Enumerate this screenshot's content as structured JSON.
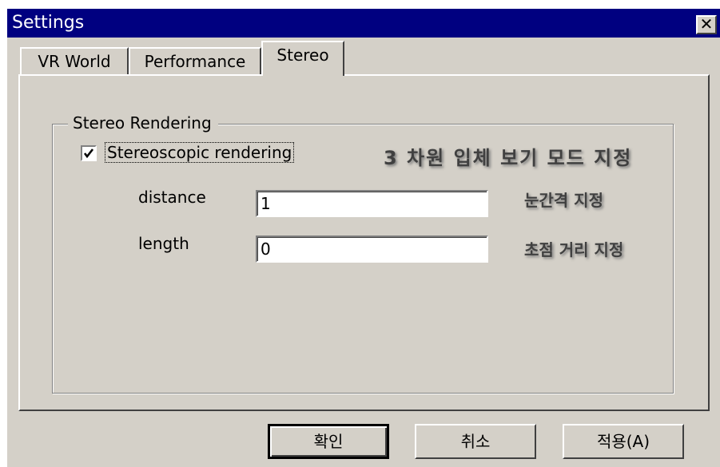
{
  "window": {
    "title": "Settings",
    "close_glyph": "✕"
  },
  "tabs": [
    {
      "label": "VR World",
      "active": false
    },
    {
      "label": "Performance",
      "active": false
    },
    {
      "label": "Stereo",
      "active": true
    }
  ],
  "group": {
    "label": "Stereo Rendering"
  },
  "checkbox": {
    "label": "Stereoscopic rendering",
    "checked": true
  },
  "fields": [
    {
      "label": "distance",
      "value": "1"
    },
    {
      "label": "length",
      "value": "0"
    }
  ],
  "annotations": {
    "stereo_mode": "3 차원 입체 보기 모드 지정",
    "eye_distance": "눈간격 지정",
    "focal_length": "초점 거리 지정"
  },
  "buttons": {
    "ok": "확인",
    "cancel": "취소",
    "apply": "적용(A)"
  },
  "colors": {
    "titlebar": "#000080",
    "face": "#d4d0c8"
  },
  "icons": {
    "close": "close-icon",
    "check": "checkmark-icon"
  }
}
